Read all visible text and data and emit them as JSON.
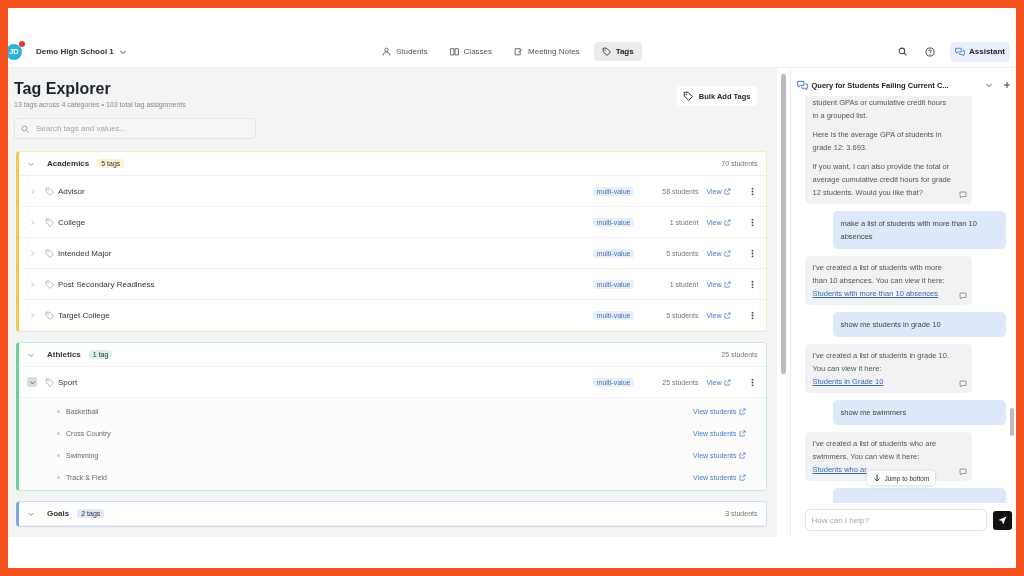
{
  "header": {
    "avatar": "JD",
    "school": "Demo High School 1",
    "nav": [
      {
        "label": "Students",
        "selected": false
      },
      {
        "label": "Classes",
        "selected": false
      },
      {
        "label": "Meeting Notes",
        "selected": false
      },
      {
        "label": "Tags",
        "selected": true
      }
    ],
    "assistant_button": "Assistant"
  },
  "explorer": {
    "title": "Tag Explorer",
    "subtitle": "13 tags across 4 categories • 103 total tag assignments",
    "bulk_button": "Bulk Add Tags",
    "search": {
      "placeholder": "Search tags and values..."
    },
    "categories": [
      {
        "name": "Academics",
        "badge": "5 tags",
        "color": "#f2c94c",
        "students": "70 students",
        "expanded": true,
        "tags": [
          {
            "name": "Advisor",
            "type": "multi-value",
            "students": "58 students",
            "link": "View",
            "expanded": false
          },
          {
            "name": "College",
            "type": "multi-value",
            "students": "1 student",
            "link": "View",
            "expanded": false
          },
          {
            "name": "Intended Major",
            "type": "multi-value",
            "students": "5 students",
            "link": "View",
            "expanded": false
          },
          {
            "name": "Post Secondary Readiness",
            "type": "multi-value",
            "students": "1 student",
            "link": "View",
            "expanded": false
          },
          {
            "name": "Target College",
            "type": "multi-value",
            "students": "5 students",
            "link": "View",
            "expanded": false
          }
        ]
      },
      {
        "name": "Athletics",
        "badge": "1 tag",
        "color": "#6fcf97",
        "students": "25 students",
        "expanded": true,
        "tags": [
          {
            "name": "Sport",
            "type": "multi-value",
            "students": "25 students",
            "link": "View",
            "expanded": true,
            "values": [
              {
                "name": "Basketball",
                "link": "View students"
              },
              {
                "name": "Cross Country",
                "link": "View students"
              },
              {
                "name": "Swimming",
                "link": "View students"
              },
              {
                "name": "Track & Field",
                "link": "View students"
              }
            ]
          }
        ]
      },
      {
        "name": "Goals",
        "badge": "2 tags",
        "color": "#7aa7e0",
        "students": "3 students",
        "expanded": true
      }
    ]
  },
  "assistant": {
    "title": "Query for Students Failing Current C...",
    "messages": [
      {
        "kind": "assistant",
        "paragraphs": [
          {
            "text": "student GPAs or cumulative credit hours in a grouped list."
          },
          {
            "text": "Here is the average GPA of students in grade 12: 3.693."
          },
          {
            "text": "If you want, I can also provide the total or average cumulative credit hours for grade 12 students. Would you like that?"
          }
        ]
      },
      {
        "kind": "user",
        "paragraphs": [
          {
            "text": "make a list of students with more than 10 absences"
          }
        ]
      },
      {
        "kind": "assistant",
        "paragraphs": [
          {
            "text": "I've created a list of students with more than 10 absences. You can view it here: ",
            "link": "Students with more than 10 absences"
          }
        ]
      },
      {
        "kind": "user",
        "paragraphs": [
          {
            "text": "show me students in grade 10"
          }
        ]
      },
      {
        "kind": "assistant",
        "paragraphs": [
          {
            "text": "I've created a list of students in grade 10. You can view it here: ",
            "link": "Students in Grade 10"
          }
        ]
      },
      {
        "kind": "user",
        "paragraphs": [
          {
            "text": "show me swimmers"
          }
        ]
      },
      {
        "kind": "assistant",
        "paragraphs": [
          {
            "text": "I've created a list of students who are swimmers. You can view it here: ",
            "link": "Students who ar"
          }
        ]
      }
    ],
    "jump_button": "Jump to bottom",
    "input": {
      "placeholder": "How can I help?"
    }
  }
}
